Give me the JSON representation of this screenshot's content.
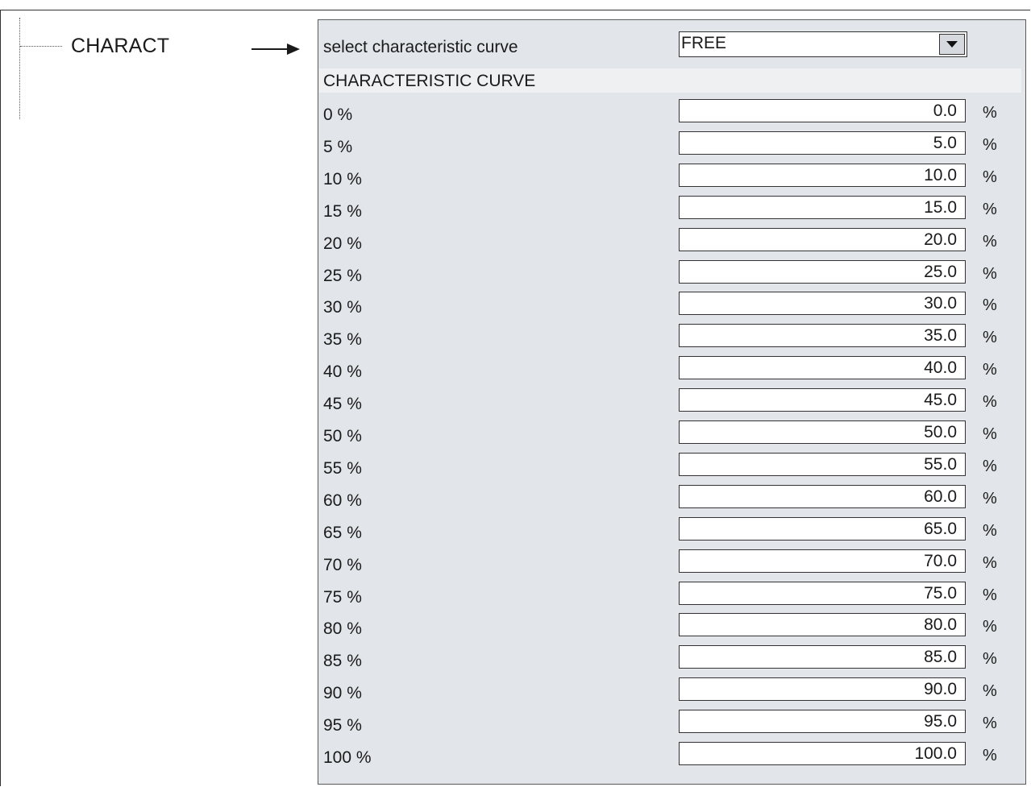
{
  "tree": {
    "node_label": "CHARACT"
  },
  "selector": {
    "label": "select characteristic curve",
    "value": "FREE"
  },
  "section": {
    "title": "CHARACTERISTIC CURVE"
  },
  "unit": "%",
  "rows": [
    {
      "label": "0 %",
      "value": "0.0"
    },
    {
      "label": "5 %",
      "value": "5.0"
    },
    {
      "label": "10 %",
      "value": "10.0"
    },
    {
      "label": "15 %",
      "value": "15.0"
    },
    {
      "label": "20 %",
      "value": "20.0"
    },
    {
      "label": "25 %",
      "value": "25.0"
    },
    {
      "label": "30 %",
      "value": "30.0"
    },
    {
      "label": "35 %",
      "value": "35.0"
    },
    {
      "label": "40 %",
      "value": "40.0"
    },
    {
      "label": "45 %",
      "value": "45.0"
    },
    {
      "label": "50 %",
      "value": "50.0"
    },
    {
      "label": "55 %",
      "value": "55.0"
    },
    {
      "label": "60 %",
      "value": "60.0"
    },
    {
      "label": "65 %",
      "value": "65.0"
    },
    {
      "label": "70 %",
      "value": "70.0"
    },
    {
      "label": "75 %",
      "value": "75.0"
    },
    {
      "label": "80 %",
      "value": "80.0"
    },
    {
      "label": "85 %",
      "value": "85.0"
    },
    {
      "label": "90 %",
      "value": "90.0"
    },
    {
      "label": "95 %",
      "value": "95.0"
    },
    {
      "label": "100 %",
      "value": "100.0"
    }
  ],
  "icons": {
    "arrow": "right-arrow-icon",
    "dropdown": "chevron-down-icon"
  }
}
